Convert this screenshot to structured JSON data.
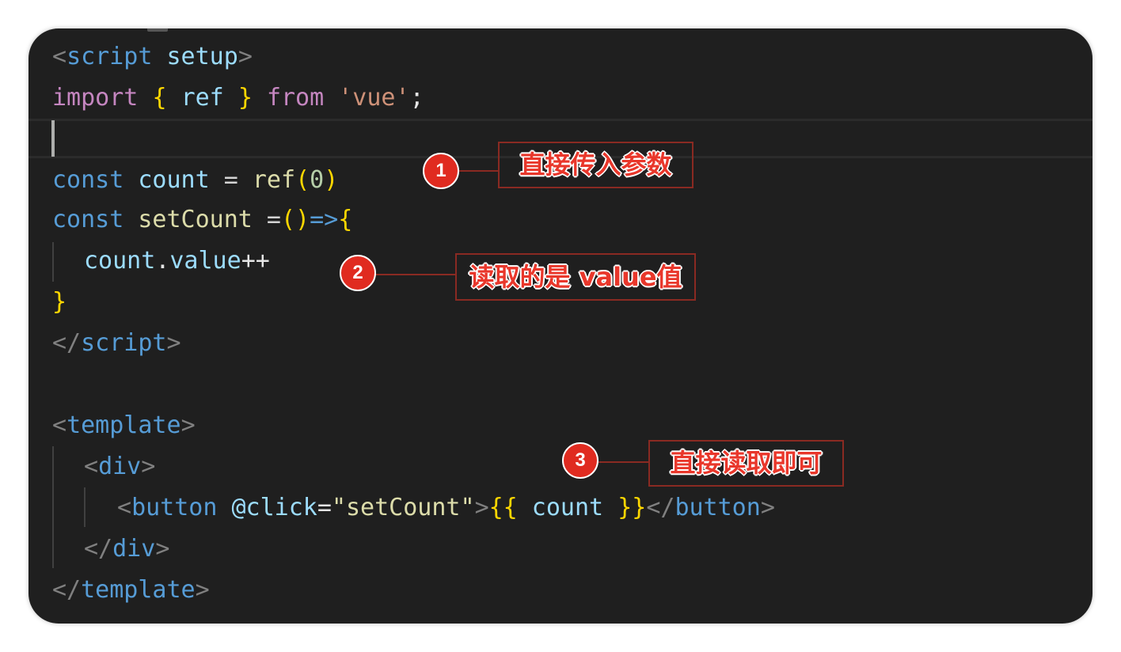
{
  "code": {
    "line1": {
      "open": "<",
      "tag": "script",
      "space": " ",
      "attr": "setup",
      "close": ">"
    },
    "line2": {
      "kw": "import",
      "sp1": " ",
      "lbrace": "{",
      "sp2": " ",
      "name": "ref",
      "sp3": " ",
      "rbrace": "}",
      "sp4": " ",
      "from": "from",
      "sp5": " ",
      "str": "'vue'",
      "semi": ";"
    },
    "line4": {
      "decl": "const",
      "sp1": " ",
      "var": "count",
      "eq": " = ",
      "fn": "ref",
      "lp": "(",
      "num": "0",
      "rp": ")"
    },
    "line5": {
      "decl": "const",
      "sp1": " ",
      "var": "setCount",
      "eq": " =",
      "parens": "()",
      "arrow": "=>",
      "lbrace": "{"
    },
    "line6": {
      "var": "count",
      "dot": ".",
      "prop": "value",
      "op": "++"
    },
    "line7": {
      "rbrace": "}"
    },
    "line8": {
      "open": "</",
      "tag": "script",
      "close": ">"
    },
    "line10": {
      "open": "<",
      "tag": "template",
      "close": ">"
    },
    "line11": {
      "open": "<",
      "tag": "div",
      "close": ">"
    },
    "line12": {
      "open": "<",
      "tag": "button",
      "sp": " ",
      "evt": "@click",
      "eq": "=",
      "val": "\"setCount\"",
      "close": ">",
      "lmus": "{{",
      "expr": " count ",
      "rmus": "}}",
      "endopen": "</",
      "endtag": "button",
      "endclose": ">"
    },
    "line13": {
      "open": "</",
      "tag": "div",
      "close": ">"
    },
    "line14": {
      "open": "</",
      "tag": "template",
      "close": ">"
    }
  },
  "annotations": [
    {
      "number": "1",
      "text": "直接传入参数"
    },
    {
      "number": "2",
      "text": "读取的是 value值"
    },
    {
      "number": "3",
      "text": "直接读取即可"
    }
  ],
  "colors": {
    "editor_background": "#1f1f1f",
    "badge": "#e02b20",
    "callout_text": "#e9372b",
    "callout_border": "#8a2a22"
  }
}
